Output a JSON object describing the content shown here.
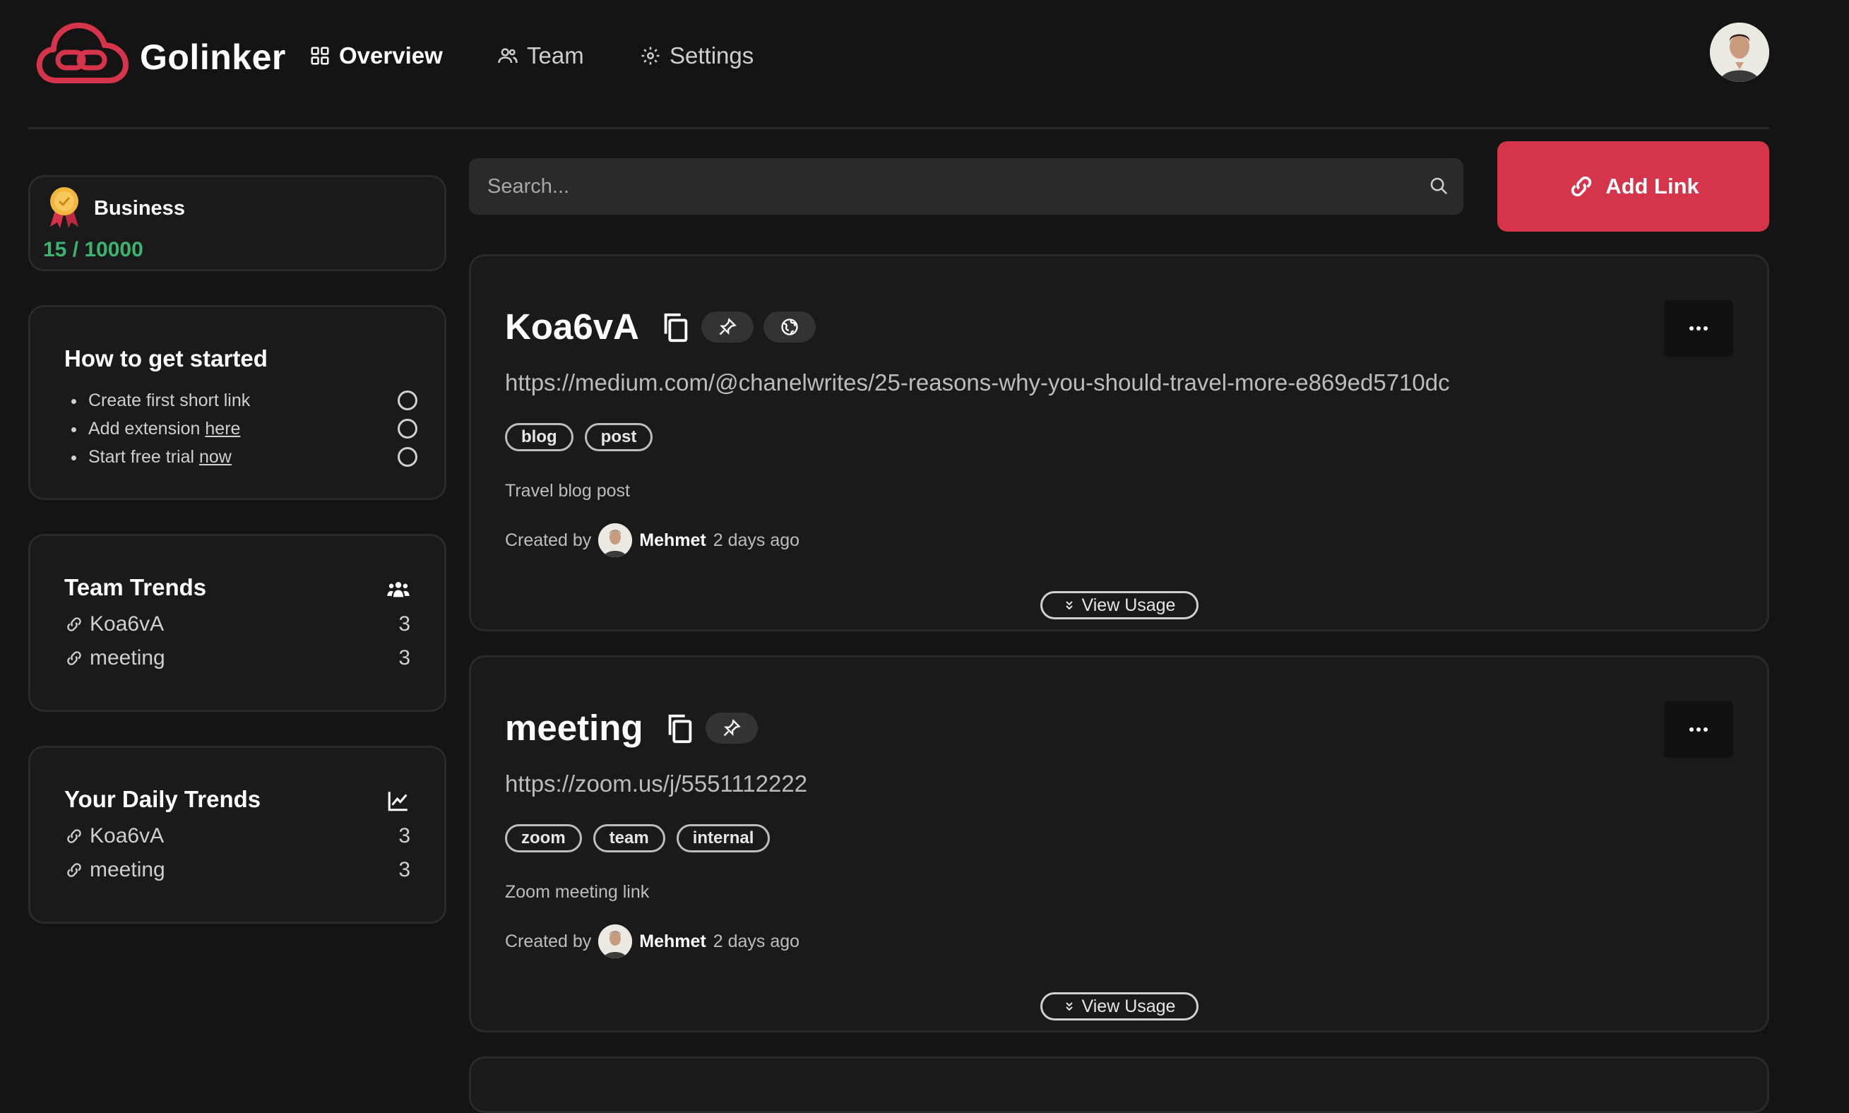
{
  "app": {
    "brand": "Golinker"
  },
  "nav": [
    {
      "label": "Overview",
      "icon": "grid-icon",
      "active": true
    },
    {
      "label": "Team",
      "icon": "users-icon",
      "active": false
    },
    {
      "label": "Settings",
      "icon": "gear-icon",
      "active": false
    }
  ],
  "plan": {
    "name": "Business",
    "usage": "15 / 10000"
  },
  "getting_started": {
    "title": "How to get started",
    "items": [
      {
        "text": "Create first short link",
        "link": ""
      },
      {
        "text": "Add extension ",
        "link": "here"
      },
      {
        "text": "Start free trial ",
        "link": "now"
      }
    ]
  },
  "team_trends": {
    "title": "Team Trends",
    "rows": [
      {
        "name": "Koa6vA",
        "count": "3"
      },
      {
        "name": "meeting",
        "count": "3"
      }
    ]
  },
  "daily_trends": {
    "title": "Your Daily Trends",
    "rows": [
      {
        "name": "Koa6vA",
        "count": "3"
      },
      {
        "name": "meeting",
        "count": "3"
      }
    ]
  },
  "search": {
    "placeholder": "Search..."
  },
  "add_link": {
    "label": "Add Link"
  },
  "links": [
    {
      "title": "Koa6vA",
      "url": "https://medium.com/@chanelwrites/25-reasons-why-you-should-travel-more-e869ed5710dc",
      "tags": [
        "blog",
        "post"
      ],
      "description": "Travel blog post",
      "created_by_label": "Created by",
      "author": "Mehmet",
      "time": "2 days ago",
      "usage_label": "View Usage"
    },
    {
      "title": "meeting",
      "url": "https://zoom.us/j/5551112222",
      "tags": [
        "zoom",
        "team",
        "internal"
      ],
      "description": "Zoom meeting link",
      "created_by_label": "Created by",
      "author": "Mehmet",
      "time": "2 days ago",
      "usage_label": "View Usage"
    }
  ],
  "colors": {
    "accent": "#d6344b",
    "success": "#3cb371",
    "background": "#141414",
    "card": "#1a1a1a"
  }
}
